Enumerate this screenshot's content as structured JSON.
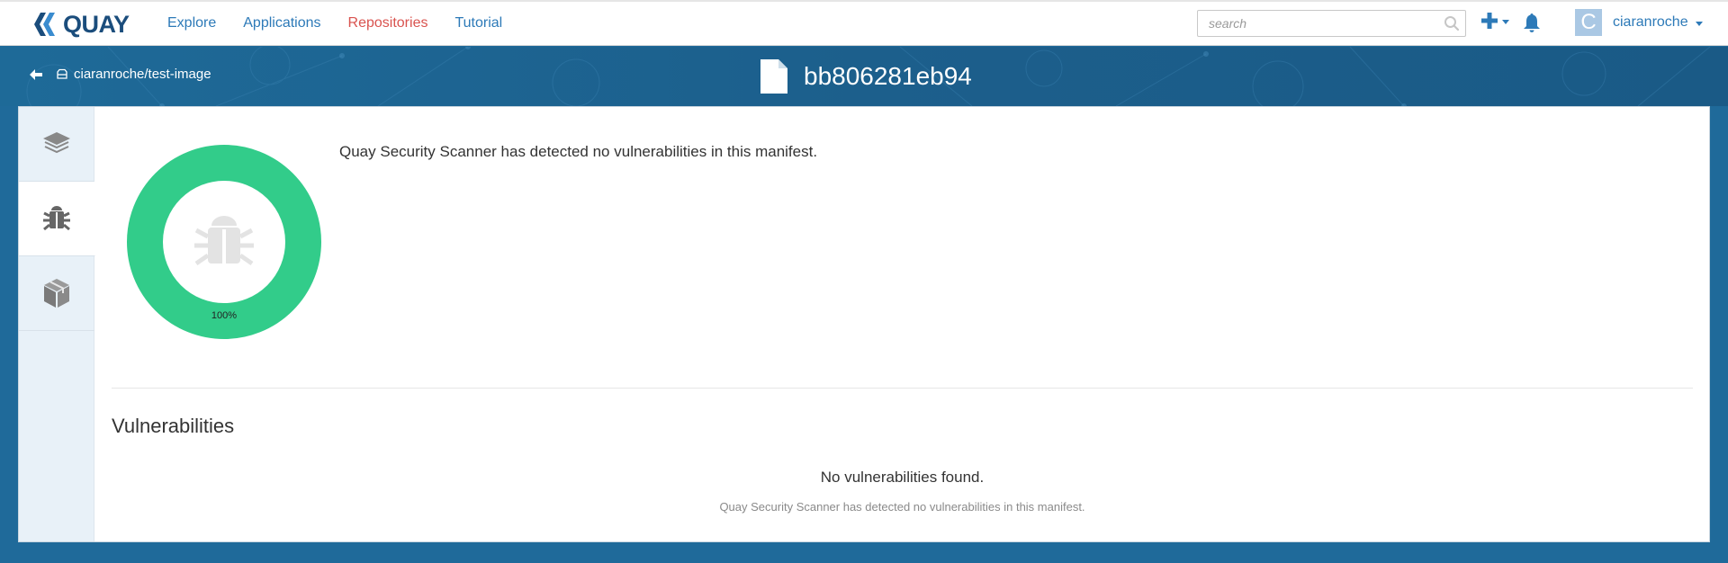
{
  "app": {
    "brand": "QUAY"
  },
  "nav": {
    "items": [
      {
        "label": "Explore",
        "active": false
      },
      {
        "label": "Applications",
        "active": false
      },
      {
        "label": "Repositories",
        "active": true
      },
      {
        "label": "Tutorial",
        "active": false
      }
    ],
    "search_placeholder": "search",
    "user": {
      "avatar_letter": "C",
      "username": "ciaranroche"
    }
  },
  "header": {
    "breadcrumb": "ciaranroche/test-image",
    "title": "bb806281eb94"
  },
  "security": {
    "scan_message": "Quay Security Scanner has detected no vulnerabilities in this manifest.",
    "donut": {
      "percent_label": "100%",
      "percent_value": 100,
      "color": "#32cc8a"
    }
  },
  "vulnerabilities": {
    "heading": "Vulnerabilities",
    "empty_title": "No vulnerabilities found.",
    "empty_subtitle": "Quay Security Scanner has detected no vulnerabilities in this manifest."
  },
  "side_tabs": [
    {
      "icon": "layers-icon",
      "active": false
    },
    {
      "icon": "bug-icon",
      "active": true
    },
    {
      "icon": "package-icon",
      "active": false
    }
  ],
  "colors": {
    "link": "#2d7ab8",
    "active_link": "#d9534f",
    "header_band": "#1e6a98",
    "success": "#32cc8a"
  }
}
